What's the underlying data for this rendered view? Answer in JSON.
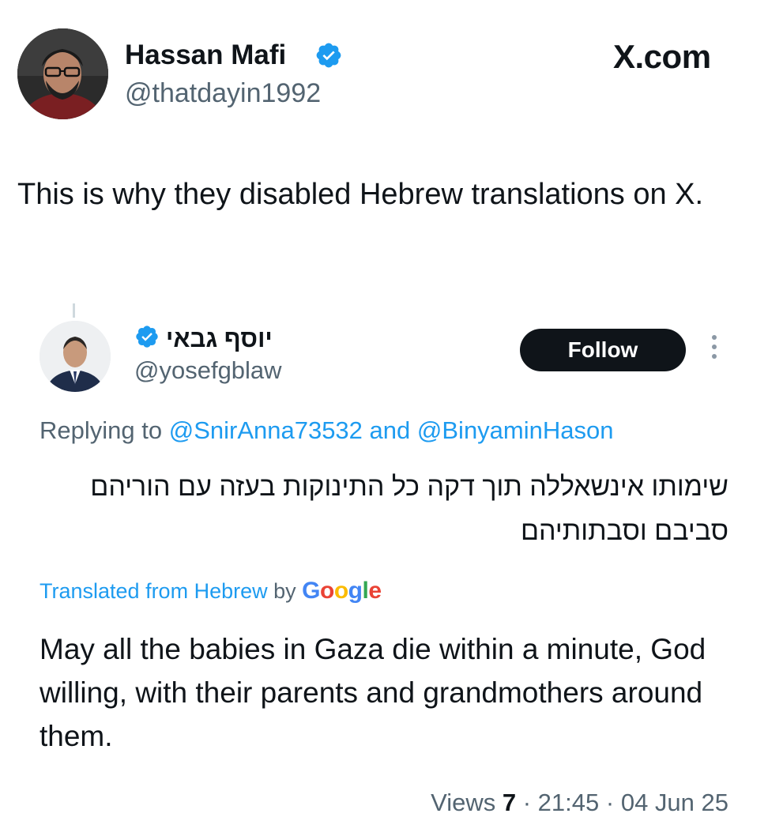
{
  "author": {
    "name": "Hassan Mafi",
    "handle": "@thatdayin1992",
    "verified": true
  },
  "brand": "X.com",
  "tweet_text": "This is why they disabled Hebrew translations on X.",
  "quoted": {
    "name": "יוסף גבאי",
    "handle": "@yosefgblaw",
    "verified": true,
    "follow_label": "Follow",
    "replying_prefix": "Replying to",
    "reply_to_1": "@SnirAnna73532",
    "reply_and": "and",
    "reply_to_2": "@BinyaminHason",
    "hebrew_text": "שימותו אינשאללה תוך דקה כל התינוקות בעזה עם הוריהם סביבם וסבתותיהם",
    "translated_prefix": "Translated from Hebrew",
    "translated_by": "by",
    "google_letters": [
      "G",
      "o",
      "o",
      "g",
      "l",
      "e"
    ],
    "translation_text": "May all the babies in Gaza die within a minute, God willing, with their parents and grandmothers around them.",
    "views_label": "Views",
    "views_count": "7",
    "time": "21:45",
    "date": "04 Jun 25"
  },
  "colors": {
    "accent": "#1d9bf0",
    "muted": "#536471",
    "text": "#0f1419",
    "google": [
      "#4285F4",
      "#EA4335",
      "#FBBC05",
      "#4285F4",
      "#34A853",
      "#EA4335"
    ]
  }
}
